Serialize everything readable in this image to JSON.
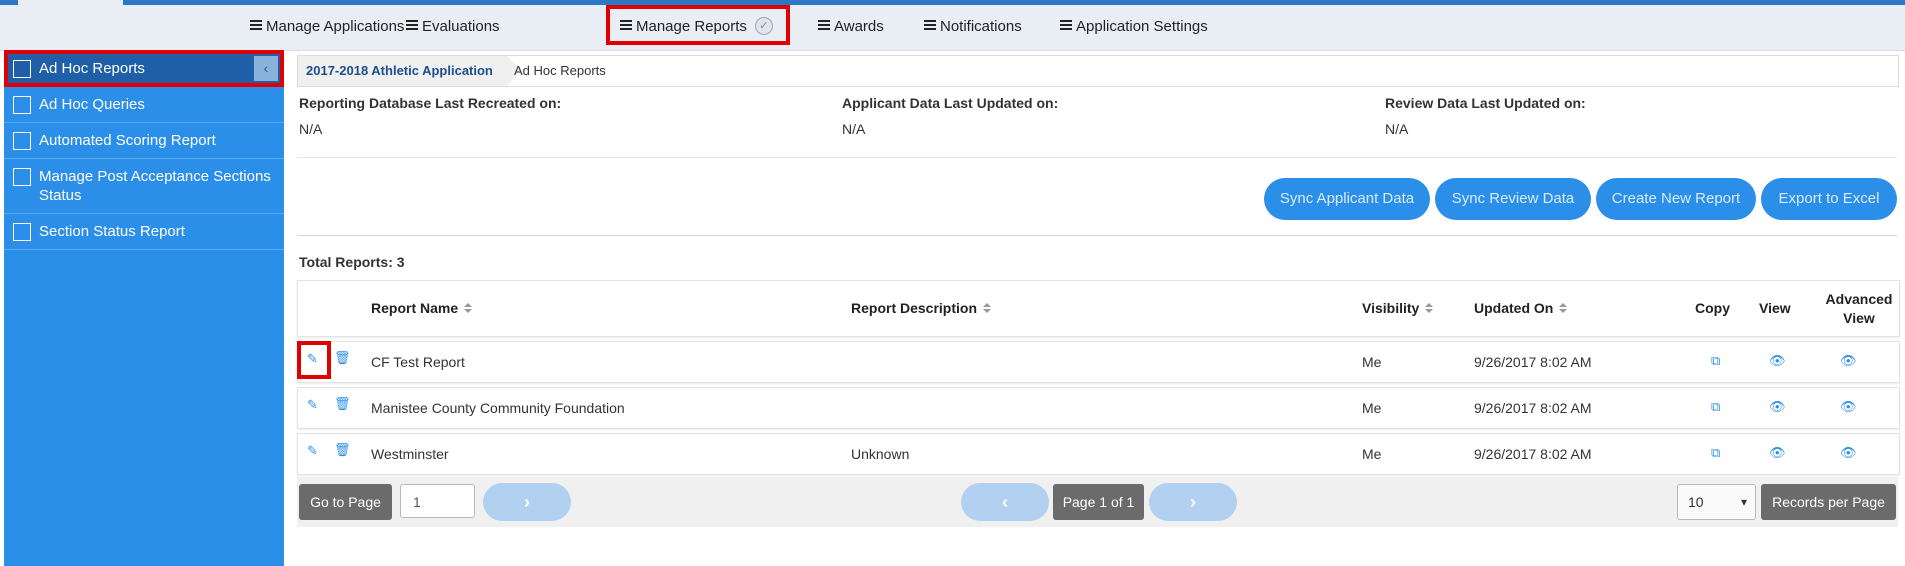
{
  "nav": {
    "items": [
      {
        "label": "Manage Applications"
      },
      {
        "label": "Evaluations"
      },
      {
        "label": "Manage Reports"
      },
      {
        "label": "Awards"
      },
      {
        "label": "Notifications"
      },
      {
        "label": "Application Settings"
      }
    ],
    "active_check": "✓"
  },
  "sidebar": {
    "collapse_glyph": "‹",
    "items": [
      {
        "label": "Ad Hoc Reports"
      },
      {
        "label": "Ad Hoc Queries"
      },
      {
        "label": "Automated Scoring Report"
      },
      {
        "label": "Manage Post Acceptance Sections Status"
      },
      {
        "label": "Section Status Report"
      }
    ]
  },
  "breadcrumb": {
    "parent": "2017-2018 Athletic Application",
    "current": "Ad Hoc Reports"
  },
  "info": {
    "reporting_label": "Reporting Database Last Recreated on:",
    "reporting_value": "N/A",
    "applicant_label": "Applicant Data Last Updated on:",
    "applicant_value": "N/A",
    "review_label": "Review Data Last Updated on:",
    "review_value": "N/A"
  },
  "actions": {
    "sync_applicant": "Sync Applicant Data",
    "sync_review": "Sync Review Data",
    "create_report": "Create New Report",
    "export_excel": "Export to Excel"
  },
  "total_reports": "Total Reports: 3",
  "table": {
    "headers": {
      "name": "Report Name",
      "description": "Report Description",
      "visibility": "Visibility",
      "updated": "Updated On",
      "copy": "Copy",
      "view": "View",
      "advanced_1": "Advanced",
      "advanced_2": "View"
    },
    "rows": [
      {
        "name": "CF Test Report",
        "description": "",
        "visibility": "Me",
        "updated": "9/26/2017 8:02 AM"
      },
      {
        "name": "Manistee County Community Foundation",
        "description": "",
        "visibility": "Me",
        "updated": "9/26/2017 8:02 AM"
      },
      {
        "name": "Westminster",
        "description": "Unknown",
        "visibility": "Me",
        "updated": "9/26/2017 8:02 AM"
      }
    ]
  },
  "pager": {
    "go_to_page": "Go to Page",
    "page_input_value": "1",
    "page_status": "Page 1 of 1",
    "records_per_page_value": "10",
    "records_per_page": "Records per Page",
    "next_glyph": "›",
    "prev_glyph": "‹"
  },
  "colors": {
    "accent": "#2b8fe9",
    "sidebar_active": "#1e5fa8",
    "highlight": "#e00000"
  }
}
